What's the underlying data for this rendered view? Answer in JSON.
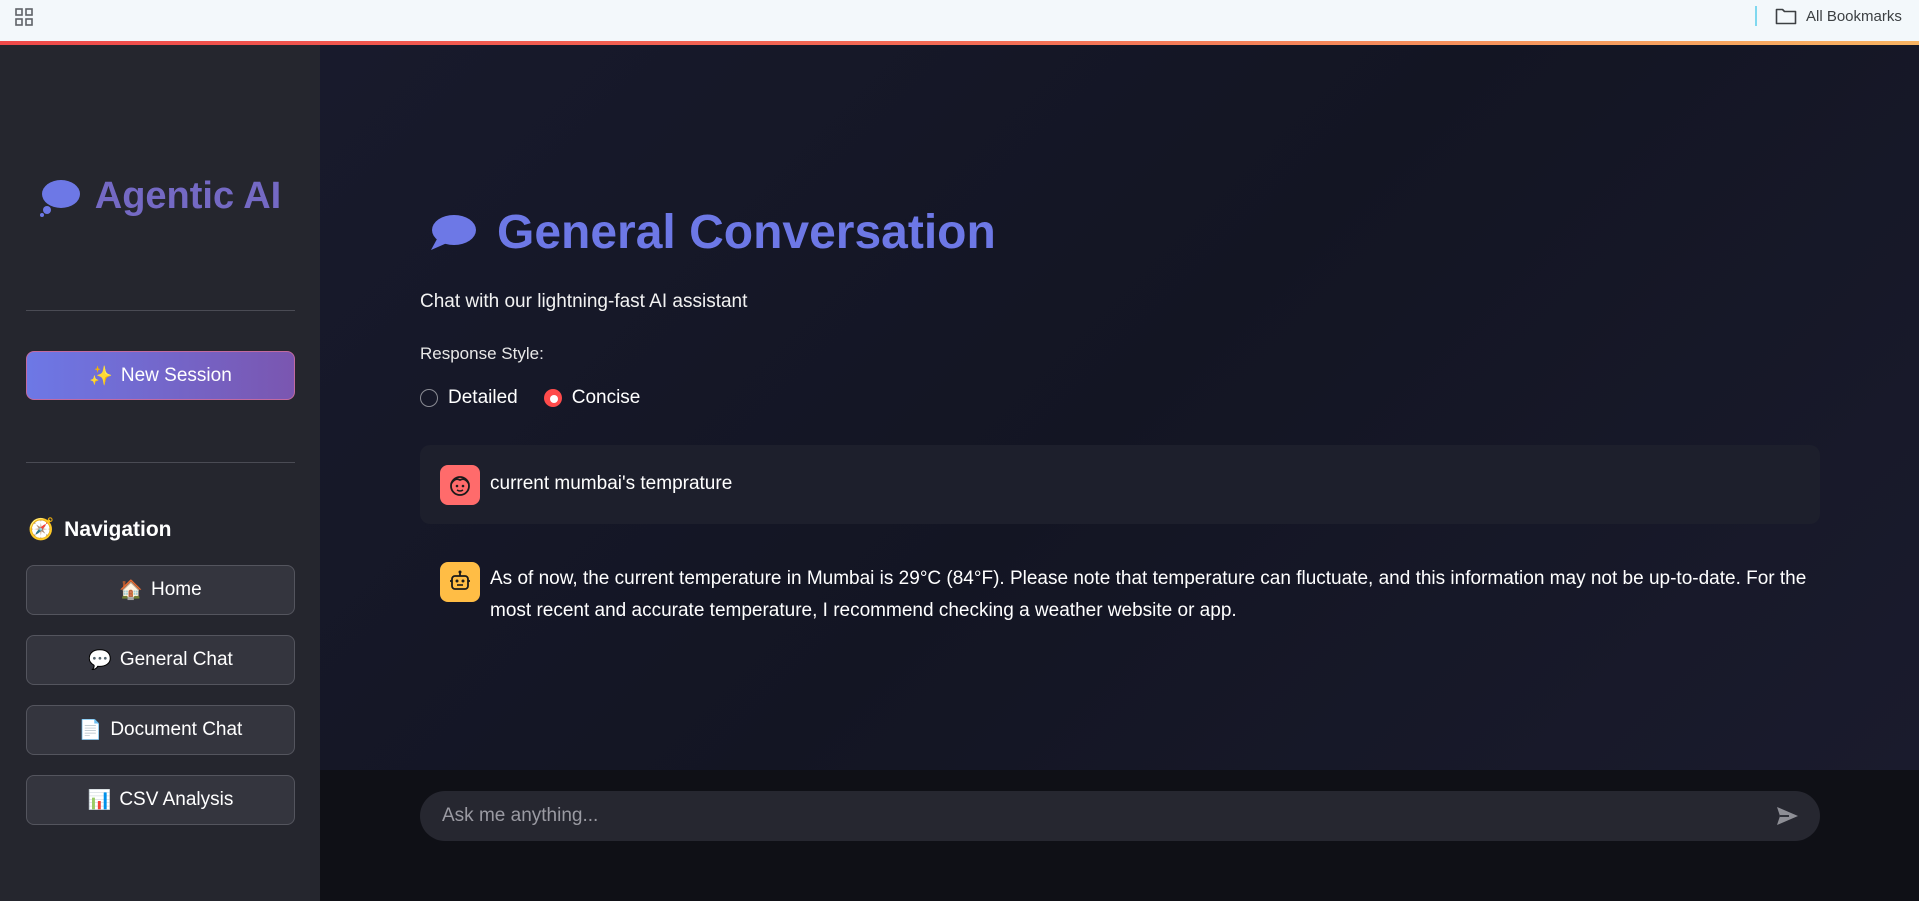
{
  "bookmarks_bar": {
    "all_bookmarks_label": "All Bookmarks"
  },
  "sidebar": {
    "brand_icon": "💭",
    "brand_title": "Agentic AI",
    "new_session": {
      "icon": "✨",
      "label": "New Session"
    },
    "nav_heading": {
      "icon": "🧭",
      "label": "Navigation"
    },
    "nav_items": [
      {
        "icon": "🏠",
        "label": "Home"
      },
      {
        "icon": "💬",
        "label": "General Chat"
      },
      {
        "icon": "📄",
        "label": "Document Chat"
      },
      {
        "icon": "📊",
        "label": "CSV Analysis"
      }
    ]
  },
  "main": {
    "title": "General Conversation",
    "subtitle": "Chat with our lightning-fast AI assistant",
    "response_style": {
      "label": "Response Style:",
      "options": [
        "Detailed",
        "Concise"
      ],
      "selected": "Concise"
    },
    "messages": [
      {
        "role": "user",
        "text": "current mumbai's temprature"
      },
      {
        "role": "assistant",
        "text": "As of now, the current temperature in Mumbai is 29°C (84°F). Please note that temperature can fluctuate, and this information may not be up-to-date. For the most recent and accurate temperature, I recommend checking a weather website or app."
      }
    ],
    "chat_input": {
      "placeholder": "Ask me anything..."
    }
  },
  "colors": {
    "accent": "#6d78e6",
    "brand": "#7469c4",
    "user_avatar": "#ff6b6b",
    "bot_avatar": "#ffbd45",
    "radio_selected": "#ff4b4b"
  }
}
